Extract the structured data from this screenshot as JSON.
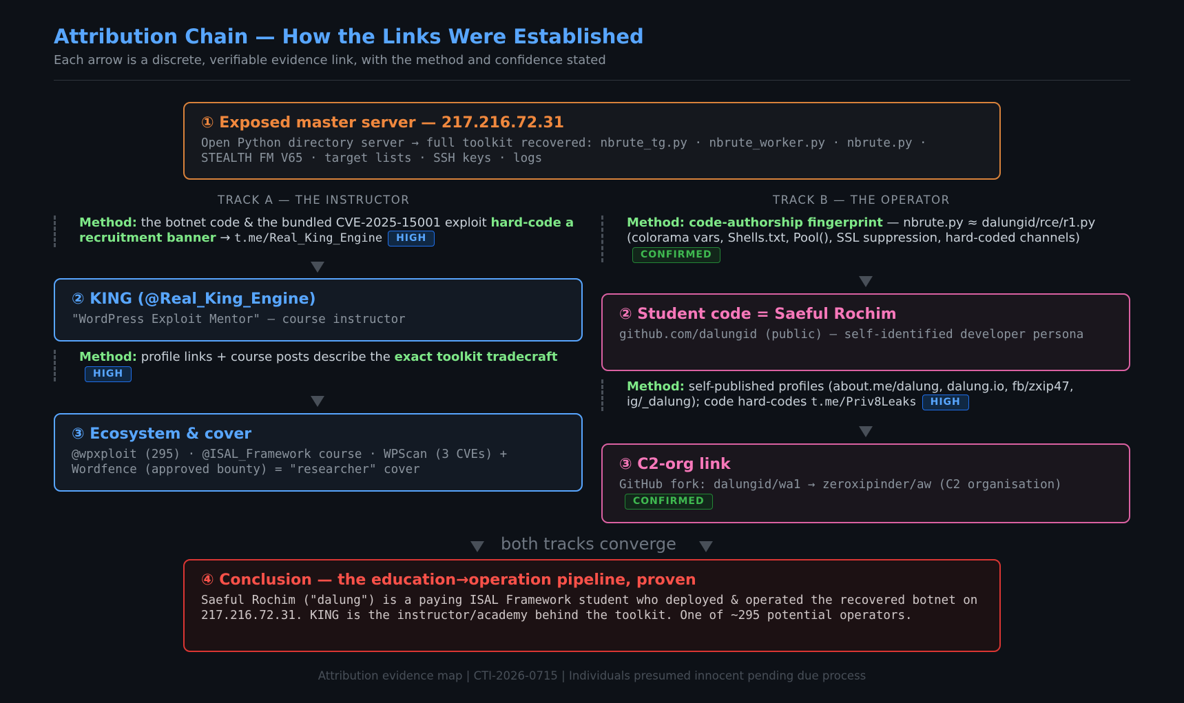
{
  "header": {
    "title": "Attribution Chain — How the Links Were Established",
    "subtitle": "Each arrow is a discrete, verifiable evidence link, with the method and confidence stated"
  },
  "master": {
    "title": "① Exposed master server — 217.216.72.31",
    "body": "Open Python directory server → full toolkit recovered: nbrute_tg.py · nbrute_worker.py · nbrute.py · STEALTH FM V65 · target lists · SSH keys · logs"
  },
  "track_a": {
    "label": "TRACK A — THE INSTRUCTOR",
    "method1": {
      "label": "Method:",
      "text1": " the botnet code & the bundled CVE-2025-15001 exploit ",
      "highlight": "hard-code a recruitment banner",
      "text2": " → ",
      "code": "t.me/Real_King_Engine",
      "badge": "HIGH"
    },
    "king": {
      "title": "② KING (@Real_King_Engine)",
      "body": "\"WordPress Exploit Mentor\" — course instructor"
    },
    "method2": {
      "label": "Method:",
      "text1": " profile links + course posts describe the ",
      "highlight": "exact toolkit tradecraft",
      "badge": "HIGH"
    },
    "eco": {
      "title": "③ Ecosystem & cover",
      "body": "@wpxploit (295) · @ISAL_Framework course · WPScan (3 CVEs) + Wordfence (approved bounty) = \"researcher\" cover"
    }
  },
  "track_b": {
    "label": "TRACK B — THE OPERATOR",
    "method1": {
      "label": "Method: code-authorship fingerprint",
      "text1": " — nbrute.py ≈ dalungid/rce/r1.py (colorama vars, Shells.txt, Pool(), SSL suppression, hard-coded channels)",
      "badge": "CONFIRMED"
    },
    "student": {
      "title": "② Student code = Saeful Rochim",
      "body": "github.com/dalungid (public) — self-identified developer persona"
    },
    "method2": {
      "label": "Method:",
      "text1": " self-published profiles (about.me/dalung, dalung.io, fb/zxip47, ig/_dalung); code hard-codes ",
      "code": "t.me/Priv8Leaks",
      "badge": "HIGH"
    },
    "c2": {
      "title": "③ C2-org link",
      "body": "GitHub fork: dalungid/wa1 → zeroxipinder/aw (C2 organisation)",
      "badge": "CONFIRMED"
    }
  },
  "converge": {
    "label": "both tracks converge"
  },
  "conclusion": {
    "title": "④ Conclusion — the education→operation pipeline, proven",
    "body": "Saeful Rochim (\"dalung\") is a paying ISAL Framework student who deployed & operated the recovered botnet on 217.216.72.31. KING is the instructor/academy behind the toolkit. One of ~295 potential operators."
  },
  "footer": {
    "text": "Attribution evidence map | CTI-2026-0715 | Individuals presumed innocent pending due process"
  }
}
